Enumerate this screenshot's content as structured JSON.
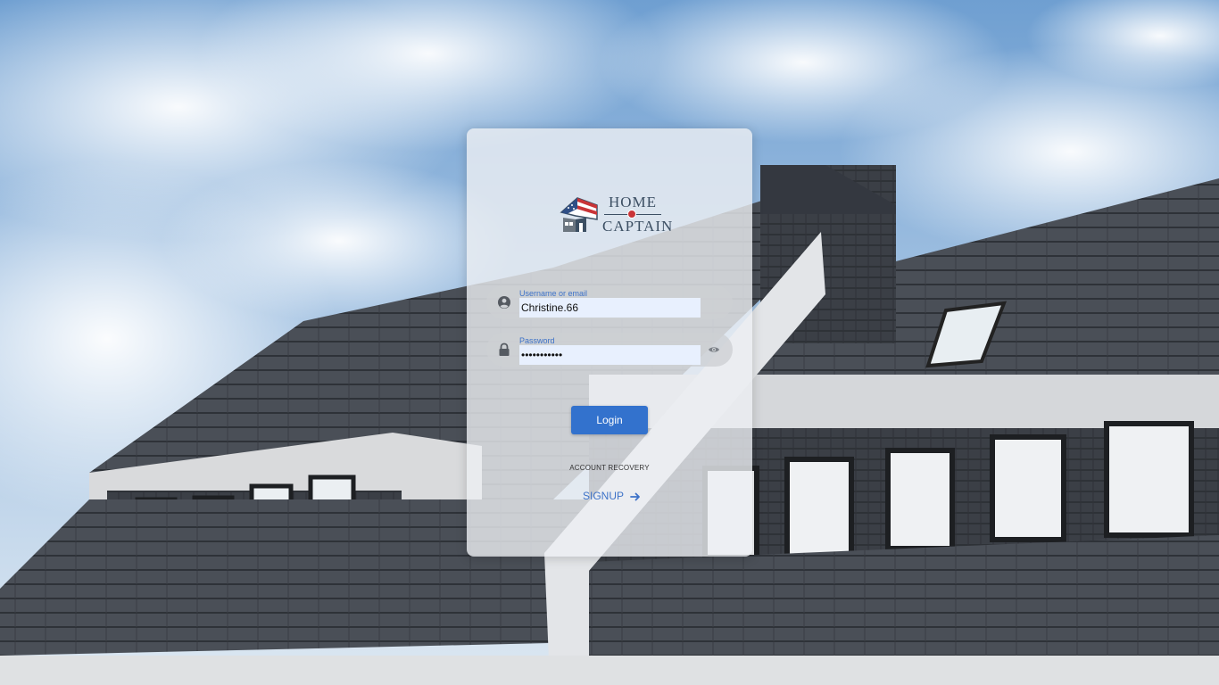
{
  "brand": {
    "name_line1": "HOME",
    "name_line2": "CAPTAIN",
    "icon": "home-captain-flag-house-logo",
    "colors": {
      "navy": "#3c4f63",
      "red": "#c93437"
    }
  },
  "login_form": {
    "username": {
      "label": "Username or email",
      "value": "Christine.66",
      "icon": "user-icon"
    },
    "password": {
      "label": "Password",
      "value": "•••••••••••",
      "icon": "lock-icon",
      "toggle_icon": "eye-icon"
    },
    "login_label": "Login",
    "account_recovery_label": "ACCOUNT RECOVERY",
    "signup_label": "SIGNUP",
    "signup_icon": "arrow-right-icon"
  },
  "colors": {
    "accent": "#3372cd",
    "link": "#3d72c8",
    "input_bg": "#e8f0fe"
  }
}
